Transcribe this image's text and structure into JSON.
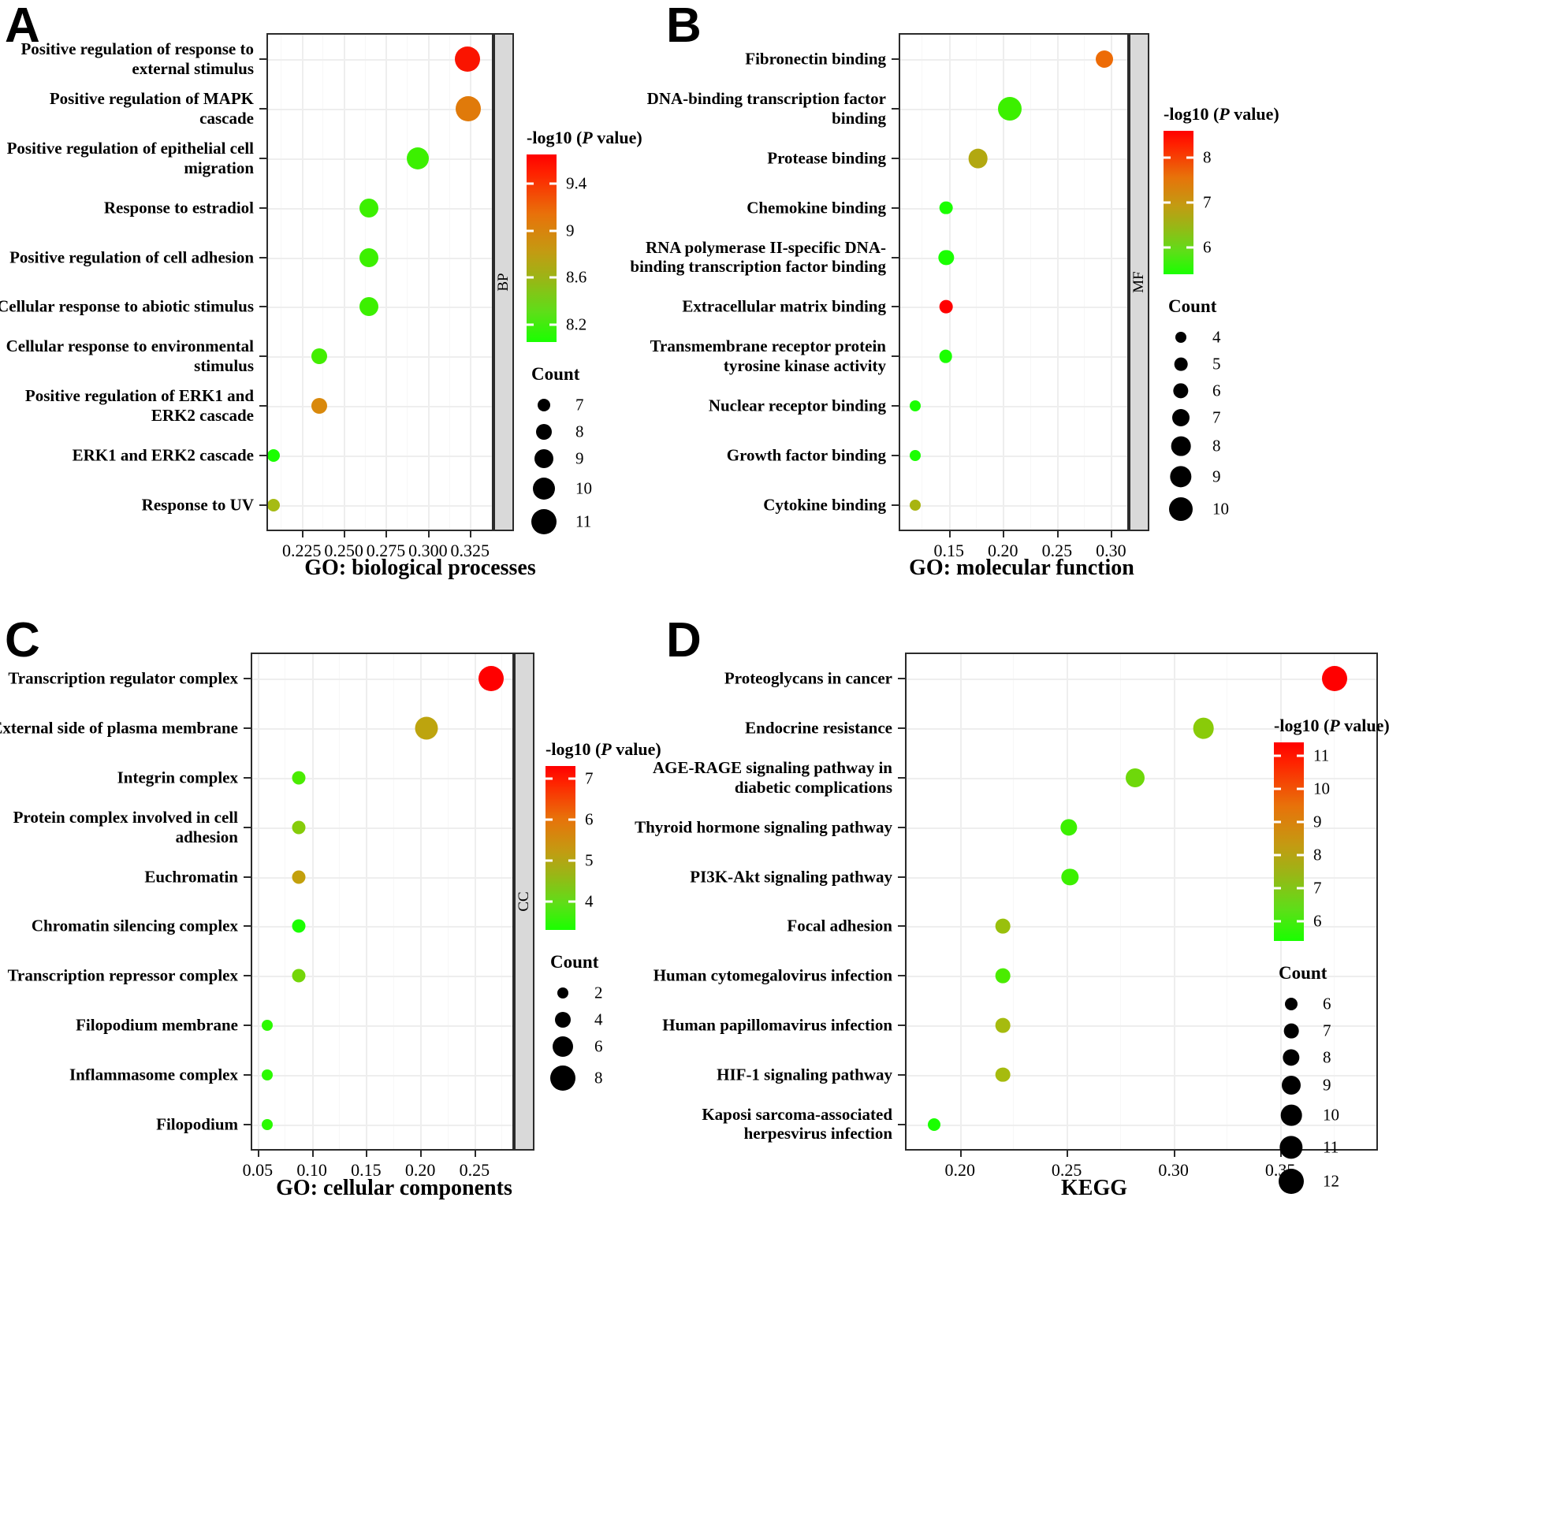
{
  "figure": {
    "panels": [
      {
        "letter": "A",
        "caption": "GO: biological processes",
        "strip_label": "BP",
        "legend": {
          "color_title_prefix": "-log10 (",
          "color_title_italic": "P",
          "color_title_suffix": " value)",
          "count_title": "Count"
        }
      },
      {
        "letter": "B",
        "caption": "GO: molecular function",
        "strip_label": "MF",
        "legend": {
          "color_title_prefix": "-log10 (",
          "color_title_italic": "P",
          "color_title_suffix": " value)",
          "count_title": "Count"
        }
      },
      {
        "letter": "C",
        "caption": "GO:  cellular components",
        "strip_label": "CC",
        "legend": {
          "color_title_prefix": "-log10 (",
          "color_title_italic": "P",
          "color_title_suffix": " value)",
          "count_title": "Count"
        }
      },
      {
        "letter": "D",
        "caption": "KEGG",
        "strip_label": "",
        "legend": {
          "color_title_prefix": "-log10 (",
          "color_title_italic": "P",
          "color_title_suffix": " value)",
          "count_title": "Count"
        }
      }
    ]
  },
  "chart_data": [
    {
      "type": "scatter",
      "panel": "A",
      "title": "GO: biological processes",
      "xlabel": "",
      "ylabel": "",
      "xlim": [
        0.205,
        0.338
      ],
      "xticks": [
        0.225,
        0.25,
        0.275,
        0.3,
        0.325
      ],
      "xtick_labels": [
        "0.225",
        "0.250",
        "0.275",
        "0.300",
        "0.325"
      ],
      "grid": true,
      "color_scale": {
        "label": "-log10 (P value)",
        "min": 8.05,
        "max": 9.65,
        "ticks": [
          8.2,
          8.6,
          9.0,
          9.4
        ],
        "low_color": "#1aff00",
        "high_color": "#ff0000"
      },
      "size_scale": {
        "label": "Count",
        "values": [
          7,
          8,
          9,
          10,
          11
        ]
      },
      "categories": [
        "Positive regulation of response to external stimulus",
        "Positive regulation of MAPK cascade",
        "Positive regulation of epithelial cell migration",
        "Response to estradiol",
        "Positive regulation of cell adhesion",
        "Cellular response to abiotic stimulus",
        "Cellular response to environmental stimulus",
        "Positive regulation of ERK1 and ERK2 cascade",
        "ERK1 and ERK2 cascade",
        "Response to UV"
      ],
      "points": [
        {
          "y": "Positive regulation of response to external stimulus",
          "x": 0.3235,
          "count": 11,
          "neglog10p": 9.62,
          "color": "#fa1400"
        },
        {
          "y": "Positive regulation of MAPK cascade",
          "x": 0.324,
          "count": 11,
          "neglog10p": 9.3,
          "color": "#e07a0a"
        },
        {
          "y": "Positive regulation of epithelial cell migration",
          "x": 0.294,
          "count": 10,
          "neglog10p": 8.25,
          "color": "#3cf000"
        },
        {
          "y": "Response to estradiol",
          "x": 0.265,
          "count": 9,
          "neglog10p": 8.22,
          "color": "#3cf000"
        },
        {
          "y": "Positive regulation of cell adhesion",
          "x": 0.265,
          "count": 9,
          "neglog10p": 8.22,
          "color": "#3cf000"
        },
        {
          "y": "Cellular response to abiotic stimulus",
          "x": 0.265,
          "count": 9,
          "neglog10p": 8.22,
          "color": "#3cf000"
        },
        {
          "y": "Cellular response to environmental stimulus",
          "x": 0.2355,
          "count": 8,
          "neglog10p": 8.23,
          "color": "#42ee00"
        },
        {
          "y": "Positive regulation of ERK1 and ERK2 cascade",
          "x": 0.2355,
          "count": 8,
          "neglog10p": 9.18,
          "color": "#d9890c"
        },
        {
          "y": "ERK1 and ERK2 cascade",
          "x": 0.2085,
          "count": 7,
          "neglog10p": 8.15,
          "color": "#1aff00"
        },
        {
          "y": "Response to UV",
          "x": 0.2085,
          "count": 7,
          "neglog10p": 8.7,
          "color": "#a6bb14"
        }
      ]
    },
    {
      "type": "scatter",
      "panel": "B",
      "title": "GO: molecular function",
      "xlabel": "",
      "ylabel": "",
      "xlim": [
        0.105,
        0.315
      ],
      "xticks": [
        0.15,
        0.2,
        0.25,
        0.3
      ],
      "xtick_labels": [
        "0.15",
        "0.20",
        "0.25",
        "0.30"
      ],
      "grid": true,
      "color_scale": {
        "label": "-log10 (P value)",
        "min": 5.4,
        "max": 8.6,
        "ticks": [
          6,
          7,
          8
        ],
        "low_color": "#1aff00",
        "high_color": "#ff0000"
      },
      "size_scale": {
        "label": "Count",
        "values": [
          4,
          5,
          6,
          7,
          8,
          9,
          10
        ]
      },
      "categories": [
        "Fibronectin binding",
        "DNA-binding transcription factor binding",
        "Protease binding",
        "Chemokine binding",
        "RNA polymerase II-specific DNA-binding transcription factor binding",
        "Extracellular matrix binding",
        "Transmembrane receptor protein tyrosine kinase activity",
        "Nuclear receptor binding",
        "Growth factor binding",
        "Cytokine binding"
      ],
      "points": [
        {
          "y": "Fibronectin binding",
          "x": 0.2935,
          "count": 7,
          "neglog10p": 8.25,
          "color": "#ed6b06"
        },
        {
          "y": "DNA-binding transcription factor binding",
          "x": 0.206,
          "count": 10,
          "neglog10p": 5.85,
          "color": "#3cf000"
        },
        {
          "y": "Protease binding",
          "x": 0.177,
          "count": 8,
          "neglog10p": 6.75,
          "color": "#b2a810"
        },
        {
          "y": "Chemokine binding",
          "x": 0.1475,
          "count": 5,
          "neglog10p": 5.65,
          "color": "#1aff00"
        },
        {
          "y": "RNA polymerase II-specific DNA-binding transcription factor binding",
          "x": 0.1475,
          "count": 6,
          "neglog10p": 5.6,
          "color": "#1aff00"
        },
        {
          "y": "Extracellular matrix binding",
          "x": 0.1475,
          "count": 5,
          "neglog10p": 8.6,
          "color": "#ff0000"
        },
        {
          "y": "Transmembrane receptor protein tyrosine kinase activity",
          "x": 0.147,
          "count": 5,
          "neglog10p": 5.55,
          "color": "#1aff00"
        },
        {
          "y": "Nuclear receptor binding",
          "x": 0.119,
          "count": 4,
          "neglog10p": 5.5,
          "color": "#1aff00"
        },
        {
          "y": "Growth factor binding",
          "x": 0.119,
          "count": 4,
          "neglog10p": 5.48,
          "color": "#1aff00"
        },
        {
          "y": "Cytokine binding",
          "x": 0.119,
          "count": 4,
          "neglog10p": 6.65,
          "color": "#a8b411"
        }
      ]
    },
    {
      "type": "scatter",
      "panel": "C",
      "title": "GO:  cellular components",
      "xlabel": "",
      "ylabel": "",
      "xlim": [
        0.045,
        0.285
      ],
      "xticks": [
        0.05,
        0.1,
        0.15,
        0.2,
        0.25
      ],
      "xtick_labels": [
        "0.05",
        "0.10",
        "0.15",
        "0.20",
        "0.25"
      ],
      "grid": true,
      "color_scale": {
        "label": "-log10 (P value)",
        "min": 3.3,
        "max": 7.3,
        "ticks": [
          4,
          5,
          6,
          7
        ],
        "low_color": "#1aff00",
        "high_color": "#ff0000"
      },
      "size_scale": {
        "label": "Count",
        "values": [
          2,
          4,
          6,
          8
        ]
      },
      "categories": [
        "Transcription regulator complex",
        "External side of plasma membrane",
        "Integrin complex",
        "Protein complex involved in cell adhesion",
        "Euchromatin",
        "Chromatin silencing complex",
        "Transcription repressor complex",
        "Filopodium membrane",
        "Inflammasome complex",
        "Filopodium"
      ],
      "points": [
        {
          "y": "Transcription regulator complex",
          "x": 0.265,
          "count": 8,
          "neglog10p": 7.25,
          "color": "#ff0000"
        },
        {
          "y": "External side of plasma membrane",
          "x": 0.206,
          "count": 7,
          "neglog10p": 5.55,
          "color": "#bda40e"
        },
        {
          "y": "Integrin complex",
          "x": 0.088,
          "count": 3,
          "neglog10p": 3.7,
          "color": "#4aec00"
        },
        {
          "y": "Protein complex involved in cell adhesion",
          "x": 0.088,
          "count": 3,
          "neglog10p": 3.95,
          "color": "#86cc0a"
        },
        {
          "y": "Euchromatin",
          "x": 0.088,
          "count": 3,
          "neglog10p": 5.3,
          "color": "#c3a00c"
        },
        {
          "y": "Chromatin silencing complex",
          "x": 0.088,
          "count": 3,
          "neglog10p": 3.45,
          "color": "#1aff00"
        },
        {
          "y": "Transcription repressor complex",
          "x": 0.088,
          "count": 3,
          "neglog10p": 3.85,
          "color": "#73d608"
        },
        {
          "y": "Filopodium membrane",
          "x": 0.059,
          "count": 2,
          "neglog10p": 3.4,
          "color": "#2bfa00"
        },
        {
          "y": "Inflammasome complex",
          "x": 0.059,
          "count": 2,
          "neglog10p": 3.4,
          "color": "#2bfa00"
        },
        {
          "y": "Filopodium",
          "x": 0.059,
          "count": 2,
          "neglog10p": 3.4,
          "color": "#2bfa00"
        }
      ]
    },
    {
      "type": "scatter",
      "panel": "D",
      "title": "KEGG",
      "xlabel": "",
      "ylabel": "",
      "xlim": [
        0.175,
        0.395
      ],
      "xticks": [
        0.2,
        0.25,
        0.3,
        0.35
      ],
      "xtick_labels": [
        "0.20",
        "0.25",
        "0.30",
        "0.35"
      ],
      "grid": true,
      "color_scale": {
        "label": "-log10 (P value)",
        "min": 5.4,
        "max": 11.4,
        "ticks": [
          6,
          7,
          8,
          9,
          10,
          11
        ],
        "low_color": "#1aff00",
        "high_color": "#ff0000"
      },
      "size_scale": {
        "label": "Count",
        "values": [
          6,
          7,
          8,
          9,
          10,
          11,
          12
        ]
      },
      "categories": [
        "Proteoglycans in cancer",
        "Endocrine resistance",
        "AGE-RAGE signaling pathway in diabetic complications",
        "Thyroid hormone signaling pathway",
        "PI3K-Akt signaling pathway",
        "Focal adhesion",
        "Human cytomegalovirus infection",
        "Human papillomavirus infection",
        "HIF-1 signaling pathway",
        "Kaposi sarcoma-associated herpesvirus infection"
      ],
      "points": [
        {
          "y": "Proteoglycans in cancer",
          "x": 0.3755,
          "count": 12,
          "neglog10p": 11.3,
          "color": "#ff0000"
        },
        {
          "y": "Endocrine resistance",
          "x": 0.314,
          "count": 10,
          "neglog10p": 7.4,
          "color": "#89cb09"
        },
        {
          "y": "AGE-RAGE signaling pathway in diabetic complications",
          "x": 0.282,
          "count": 9,
          "neglog10p": 7.1,
          "color": "#6ed80a"
        },
        {
          "y": "Thyroid hormone signaling pathway",
          "x": 0.251,
          "count": 8,
          "neglog10p": 6.1,
          "color": "#3cf000"
        },
        {
          "y": "PI3K-Akt signaling pathway",
          "x": 0.2515,
          "count": 8,
          "neglog10p": 6.05,
          "color": "#3cf000"
        },
        {
          "y": "Focal adhesion",
          "x": 0.22,
          "count": 7,
          "neglog10p": 6.9,
          "color": "#99c00c"
        },
        {
          "y": "Human cytomegalovirus infection",
          "x": 0.22,
          "count": 7,
          "neglog10p": 6.15,
          "color": "#4aec00"
        },
        {
          "y": "Human papillomavirus infection",
          "x": 0.22,
          "count": 7,
          "neglog10p": 6.8,
          "color": "#a6bb0e"
        },
        {
          "y": "HIF-1 signaling pathway",
          "x": 0.22,
          "count": 7,
          "neglog10p": 6.85,
          "color": "#a6bb0e"
        },
        {
          "y": "Kaposi sarcoma-associated herpesvirus infection",
          "x": 0.188,
          "count": 6,
          "neglog10p": 5.55,
          "color": "#1aff00"
        }
      ]
    }
  ]
}
